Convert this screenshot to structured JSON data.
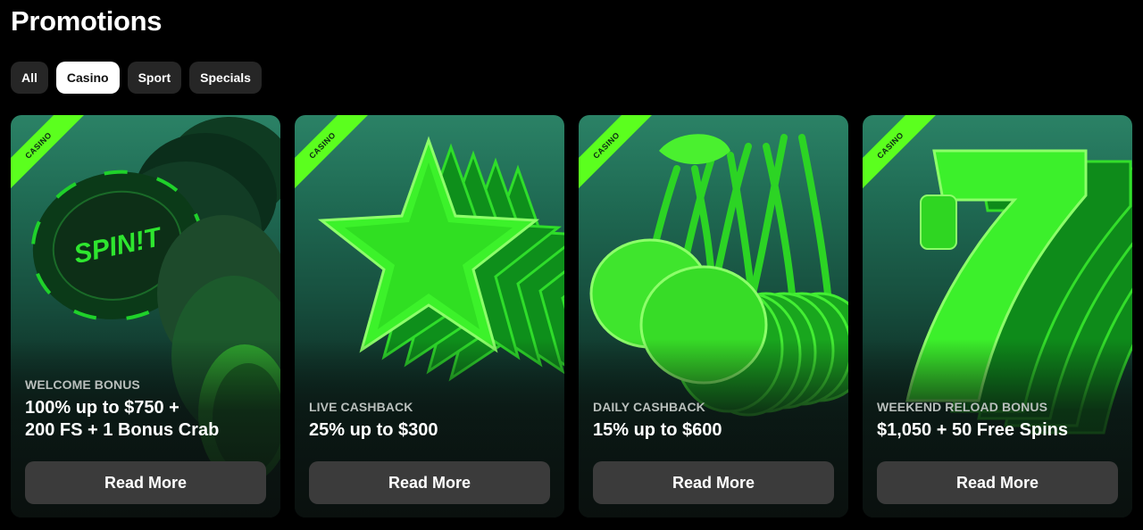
{
  "page": {
    "title": "Promotions"
  },
  "filters": [
    {
      "label": "All",
      "active": false
    },
    {
      "label": "Casino",
      "active": true
    },
    {
      "label": "Sport",
      "active": false
    },
    {
      "label": "Specials",
      "active": false
    }
  ],
  "cards": [
    {
      "tag": "CASINO",
      "kicker": "WELCOME BONUS",
      "headline": "100% up to $750 +\n200 FS + 1 Bonus Crab",
      "button": "Read More",
      "art": "poker-chips-icon",
      "art_text": "SPIN!T"
    },
    {
      "tag": "CASINO",
      "kicker": "LIVE CASHBACK",
      "headline": "25% up to $300",
      "button": "Read More",
      "art": "star-icon"
    },
    {
      "tag": "CASINO",
      "kicker": "DAILY CASHBACK",
      "headline": "15% up to $600",
      "button": "Read More",
      "art": "cherries-icon"
    },
    {
      "tag": "CASINO",
      "kicker": "WEEKEND RELOAD BONUS",
      "headline": "$1,050 + 50 Free Spins",
      "button": "Read More",
      "art": "lucky-seven-icon"
    }
  ],
  "colors": {
    "accent": "#5bff1e",
    "card_top": "#2b8266",
    "button": "#3b3b3b"
  }
}
